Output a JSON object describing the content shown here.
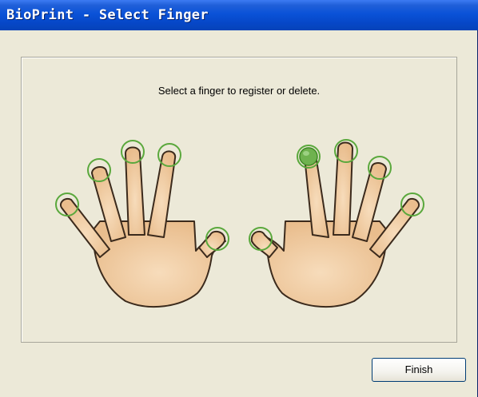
{
  "window": {
    "title": "BioPrint - Select Finger"
  },
  "panel": {
    "instruction": "Select a finger to register or delete."
  },
  "buttons": {
    "finish_label": "Finish"
  },
  "fingers": {
    "left_hand": [
      {
        "name": "left-little",
        "registered": false
      },
      {
        "name": "left-ring",
        "registered": false
      },
      {
        "name": "left-middle",
        "registered": false
      },
      {
        "name": "left-index",
        "registered": false
      },
      {
        "name": "left-thumb",
        "registered": false
      }
    ],
    "right_hand": [
      {
        "name": "right-thumb",
        "registered": false
      },
      {
        "name": "right-index",
        "registered": true
      },
      {
        "name": "right-middle",
        "registered": false
      },
      {
        "name": "right-ring",
        "registered": false
      },
      {
        "name": "right-little",
        "registered": false
      }
    ]
  },
  "colors": {
    "title_bar": "#0a52d8",
    "skin": "#f2cfa6",
    "selector_ring": "#5aa83c",
    "selected_fill": "#6fb24f"
  }
}
